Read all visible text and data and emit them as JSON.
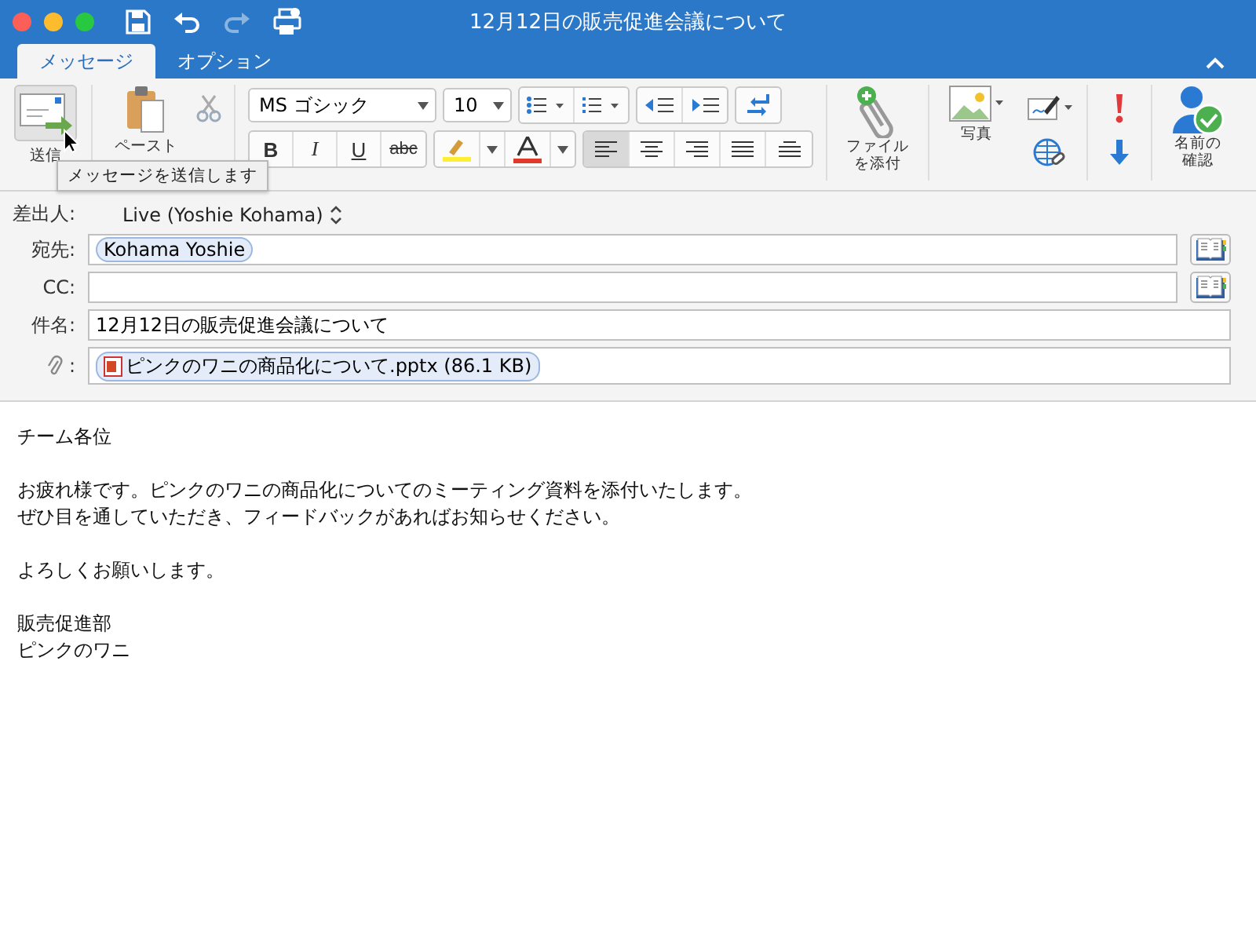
{
  "window": {
    "title": "12月12日の販売促進会議について"
  },
  "tabs": [
    {
      "label": "メッセージ",
      "selected": true
    },
    {
      "label": "オプション",
      "selected": false
    }
  ],
  "ribbon": {
    "send": {
      "label": "送信"
    },
    "tooltip": "メッセージを送信します",
    "paste": {
      "label": "ペースト"
    },
    "font": {
      "name": "MS ゴシック",
      "size": "10"
    },
    "format_buttons": [
      {
        "label": "B",
        "kind": "bold"
      },
      {
        "label": "I",
        "kind": "italic"
      },
      {
        "label": "U",
        "kind": "underline"
      },
      {
        "label": "abc",
        "kind": "strike"
      }
    ],
    "align_buttons": [
      {
        "kind": "left",
        "selected": true
      },
      {
        "kind": "center",
        "selected": false
      },
      {
        "kind": "right",
        "selected": false
      },
      {
        "kind": "justify",
        "selected": false
      },
      {
        "kind": "distribute",
        "selected": false
      }
    ],
    "attach": {
      "lines": [
        "ファイル",
        "を添付"
      ]
    },
    "photo": {
      "label": "写真"
    },
    "check_names": {
      "lines": [
        "名前の",
        "確認"
      ]
    }
  },
  "header": {
    "from": {
      "label": "差出人:",
      "value": "Live (Yoshie Kohama)"
    },
    "to": {
      "label": "宛先:",
      "recipients": [
        "Kohama Yoshie"
      ]
    },
    "cc": {
      "label": "CC:"
    },
    "subject": {
      "label": "件名:",
      "value": "12月12日の販売促進会議について"
    },
    "attachments": {
      "label": ":",
      "files": [
        "ピンクのワニの商品化について.pptx (86.1 KB)"
      ]
    }
  },
  "body": {
    "paragraphs": [
      [
        "チーム各位"
      ],
      [
        "お疲れ様です。ピンクのワニの商品化についてのミーティング資料を添付いたします。",
        "ぜひ目を通していただき、フィードバックがあればお知らせください。"
      ],
      [
        "よろしくお願いします。"
      ],
      [
        "販売促進部",
        "ピンクのワニ"
      ]
    ]
  }
}
